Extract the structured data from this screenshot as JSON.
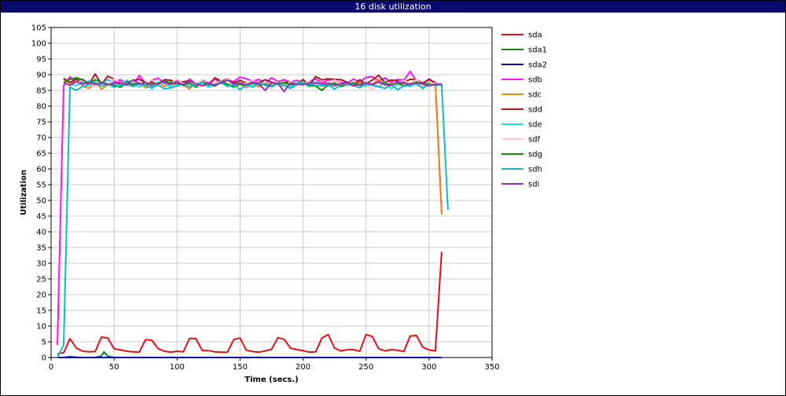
{
  "window": {
    "title": "16 disk utilization"
  },
  "chart_data": {
    "type": "line",
    "title": "16 disk utilization",
    "xlabel": "Time (secs.)",
    "ylabel": "Utilization",
    "xlim": [
      0,
      350
    ],
    "ylim": [
      0,
      105
    ],
    "xticks": [
      0,
      50,
      100,
      150,
      200,
      250,
      300,
      350
    ],
    "yticks": [
      0,
      5,
      10,
      15,
      20,
      25,
      30,
      35,
      40,
      45,
      50,
      55,
      60,
      65,
      70,
      75,
      80,
      85,
      90,
      95,
      100,
      105
    ],
    "grid": true,
    "legend_position": "right",
    "series": [
      {
        "name": "sda",
        "color": "#e0101a",
        "x": [
          5,
          10,
          15,
          20,
          25,
          30,
          35,
          40,
          45,
          50,
          55,
          60,
          65,
          70,
          75,
          80,
          85,
          90,
          95,
          100,
          105,
          110,
          115,
          120,
          125,
          130,
          135,
          140,
          145,
          150,
          155,
          160,
          165,
          170,
          175,
          180,
          185,
          190,
          195,
          200,
          205,
          210,
          215,
          220,
          225,
          230,
          235,
          240,
          245,
          250,
          255,
          260,
          265,
          270,
          275,
          280,
          285,
          290,
          295,
          300,
          305,
          310
        ],
        "y": [
          1.2,
          1.5,
          6.0,
          3.0,
          2.0,
          1.8,
          1.9,
          6.5,
          6.2,
          2.8,
          2.4,
          2.0,
          1.8,
          1.7,
          5.7,
          5.5,
          2.8,
          2.0,
          1.7,
          2.0,
          1.8,
          6.1,
          6.0,
          2.2,
          2.2,
          1.8,
          1.7,
          1.7,
          5.7,
          6.2,
          2.3,
          1.9,
          1.7,
          2.1,
          2.6,
          6.3,
          5.8,
          3.0,
          2.5,
          2.2,
          1.7,
          1.8,
          6.2,
          7.3,
          3.0,
          2.1,
          2.5,
          2.5,
          2.0,
          7.3,
          6.7,
          2.8,
          2.1,
          2.5,
          2.3,
          1.9,
          6.8,
          7.0,
          3.3,
          2.4,
          2.1,
          33.6
        ]
      },
      {
        "name": "sda1",
        "color": "#0a8a0a",
        "x": [
          5,
          10,
          15,
          20,
          25,
          30,
          35,
          40,
          42,
          45,
          50,
          55,
          60,
          100,
          150,
          200,
          250,
          300,
          310
        ],
        "y": [
          0,
          0,
          0.3,
          0.1,
          0,
          0,
          0,
          0.5,
          1.8,
          0.4,
          0,
          0,
          0,
          0,
          0,
          0,
          0,
          0,
          0
        ]
      },
      {
        "name": "sda2",
        "color": "#0a0aa8",
        "x": [
          5,
          310
        ],
        "y": [
          0,
          0
        ]
      },
      {
        "name": "sdb",
        "color": "#ff10ff",
        "x": [
          5,
          10,
          15,
          20,
          25,
          30,
          35,
          40,
          45,
          50,
          55,
          60,
          65,
          70,
          75,
          80,
          85,
          90,
          95,
          100,
          105,
          110,
          115,
          120,
          125,
          130,
          135,
          140,
          145,
          150,
          155,
          160,
          165,
          170,
          175,
          180,
          185,
          190,
          195,
          200,
          205,
          210,
          215,
          220,
          225,
          230,
          235,
          240,
          245,
          250,
          255,
          260,
          265,
          270,
          275,
          280,
          285,
          290,
          295,
          300,
          305,
          310
        ],
        "y": [
          4,
          86.5,
          89.3,
          87.5,
          88.6,
          87.0,
          86.5,
          87.2,
          88.4,
          87.6,
          88.4,
          87.2,
          86.8,
          89.7,
          87.3,
          88.2,
          88.9,
          87.0,
          87.6,
          88.1,
          86.8,
          88.6,
          87.0,
          88.2,
          87.3,
          88.6,
          87.2,
          88.3,
          87.8,
          89.2,
          88.7,
          87.9,
          88.5,
          87.2,
          89.0,
          87.8,
          88.4,
          87.6,
          88.2,
          87.3,
          87.8,
          88.6,
          87.4,
          88.3,
          88.1,
          87.5,
          87.3,
          88.6,
          87.7,
          89.1,
          89.4,
          87.8,
          89.0,
          87.6,
          88.5,
          88.2,
          91.0,
          88.0,
          87.4,
          88.3,
          87.6,
          46.0
        ]
      },
      {
        "name": "sdc",
        "color": "#e08a10",
        "x": [
          10,
          15,
          20,
          25,
          30,
          35,
          40,
          45,
          50,
          55,
          60,
          65,
          70,
          75,
          80,
          85,
          90,
          95,
          100,
          105,
          110,
          115,
          120,
          125,
          130,
          135,
          140,
          145,
          150,
          155,
          160,
          165,
          170,
          175,
          180,
          185,
          190,
          195,
          200,
          205,
          210,
          215,
          220,
          225,
          230,
          235,
          240,
          245,
          250,
          255,
          260,
          265,
          270,
          275,
          280,
          285,
          290,
          295,
          300,
          305,
          310
        ],
        "y": [
          88.5,
          87.0,
          88.0,
          86.5,
          85.6,
          87.6,
          85.4,
          86.8,
          87.4,
          86.6,
          86.9,
          86.2,
          87.6,
          85.8,
          86.5,
          87.4,
          86.2,
          87.1,
          87.0,
          86.6,
          85.5,
          87.4,
          86.4,
          86.8,
          86.4,
          87.6,
          86.2,
          86.8,
          87.0,
          85.8,
          87.3,
          86.2,
          87.4,
          86.9,
          87.1,
          86.3,
          87.6,
          87.0,
          88.5,
          86.5,
          87.7,
          87.2,
          87.5,
          86.4,
          87.3,
          86.9,
          86.5,
          87.6,
          86.7,
          86.9,
          88.5,
          86.6,
          87.3,
          86.7,
          87.5,
          86.9,
          87.5,
          86.9,
          87.4,
          87.2,
          45.5
        ]
      },
      {
        "name": "sdd",
        "color": "#a81a1a",
        "x": [
          10,
          15,
          20,
          25,
          30,
          35,
          40,
          45,
          50,
          55,
          60,
          65,
          70,
          75,
          80,
          85,
          90,
          95,
          100,
          105,
          110,
          115,
          120,
          125,
          130,
          135,
          140,
          145,
          150,
          155,
          160,
          165,
          170,
          175,
          180,
          185,
          190,
          195,
          200,
          205,
          210,
          215,
          220,
          225,
          230,
          235,
          240,
          245,
          250,
          255,
          260,
          265,
          270,
          275,
          280,
          285,
          290,
          295,
          300,
          305,
          310
        ],
        "y": [
          88.8,
          87.5,
          88.6,
          87.5,
          86.9,
          90.2,
          87.0,
          89.5,
          88.6,
          86.8,
          87.6,
          88.1,
          88.5,
          87.4,
          87.8,
          87.0,
          88.4,
          88.2,
          87.3,
          87.8,
          88.0,
          87.1,
          87.5,
          86.6,
          89.0,
          87.9,
          88.6,
          87.3,
          88.2,
          87.3,
          88.0,
          87.4,
          88.4,
          87.6,
          87.2,
          87.5,
          87.7,
          87.1,
          88.4,
          86.5,
          89.4,
          88.3,
          88.7,
          88.5,
          88.4,
          87.6,
          86.6,
          88.4,
          87.0,
          88.3,
          89.8,
          87.5,
          88.3,
          88.0,
          87.5,
          88.5,
          88.4,
          87.2,
          88.6,
          87.3,
          87.0
        ]
      },
      {
        "name": "sde",
        "color": "#20e0e0",
        "x": [
          15,
          20,
          25,
          30,
          35,
          40,
          45,
          50,
          55,
          60,
          65,
          70,
          75,
          80,
          85,
          90,
          95,
          100,
          105,
          110,
          115,
          120,
          125,
          130,
          135,
          140,
          145,
          150,
          155,
          160,
          165,
          170,
          175,
          180,
          185,
          190,
          195,
          200,
          205,
          210,
          215,
          220,
          225,
          230,
          235,
          240,
          245,
          250,
          255,
          260,
          265,
          270,
          275,
          280,
          285,
          290,
          295,
          300,
          305,
          310
        ],
        "y": [
          87.0,
          86.6,
          87.4,
          88.0,
          86.9,
          87.0,
          88.3,
          87.2,
          86.5,
          88.3,
          87.5,
          86.0,
          87.6,
          85.4,
          87.6,
          87.3,
          86.0,
          86.8,
          87.3,
          86.2,
          87.4,
          87.6,
          86.0,
          86.8,
          88.1,
          86.9,
          85.8,
          87.2,
          86.6,
          86.8,
          87.0,
          87.5,
          86.3,
          87.4,
          86.7,
          86.0,
          87.4,
          87.6,
          86.1,
          87.5,
          87.1,
          86.3,
          86.8,
          87.0,
          86.4,
          87.3,
          86.7,
          86.4,
          87.0,
          86.0,
          87.5,
          85.5,
          87.0,
          86.5,
          86.3,
          87.3,
          85.5,
          87.2,
          86.5,
          87.0
        ]
      },
      {
        "name": "sdf",
        "color": "#ffc8c8",
        "x": [
          10,
          15,
          20,
          25,
          30,
          35,
          40,
          45,
          50,
          55,
          60,
          65,
          70,
          75,
          80,
          85,
          90,
          95,
          100,
          105,
          110,
          115,
          120,
          125,
          130,
          135,
          140,
          145,
          150,
          155,
          160,
          165,
          170,
          175,
          180,
          185,
          190,
          195,
          200,
          205,
          210,
          215,
          220,
          225,
          230,
          235,
          240,
          245,
          250,
          255,
          260,
          265,
          270,
          275,
          280,
          285,
          290,
          295,
          300,
          305,
          310
        ],
        "y": [
          87.8,
          86.8,
          87.4,
          88.2,
          87.0,
          86.5,
          87.8,
          87.0,
          88.6,
          87.4,
          86.8,
          87.9,
          87.4,
          87.0,
          88.4,
          86.9,
          87.6,
          87.2,
          88.6,
          87.0,
          86.8,
          87.5,
          88.0,
          86.9,
          87.6,
          87.4,
          88.5,
          86.6,
          87.4,
          87.2,
          88.3,
          86.8,
          87.5,
          85.4,
          87.6,
          86.4,
          87.8,
          87.0,
          87.2,
          87.8,
          86.4,
          85.0,
          87.6,
          88.3,
          87.0,
          86.7,
          87.6,
          86.4,
          87.0,
          85.2,
          86.8,
          87.2,
          86.6,
          87.7,
          88.0,
          87.2,
          88.4,
          86.6,
          87.2,
          87.3,
          87.0
        ]
      },
      {
        "name": "sdg",
        "color": "#10900a",
        "x": [
          10,
          15,
          20,
          25,
          30,
          35,
          40,
          45,
          50,
          55,
          60,
          65,
          70,
          75,
          80,
          85,
          90,
          95,
          100,
          105,
          110,
          115,
          120,
          125,
          130,
          135,
          140,
          145,
          150,
          155,
          160,
          165,
          170,
          175,
          180,
          185,
          190,
          195,
          200,
          205,
          210,
          215,
          220,
          225,
          230,
          235,
          240,
          245,
          250,
          255,
          260,
          265,
          270,
          275,
          280,
          285,
          290,
          295,
          300,
          305,
          310
        ],
        "y": [
          87.5,
          88.5,
          89.0,
          88.4,
          87.0,
          88.4,
          87.6,
          87.0,
          86.6,
          86.0,
          87.4,
          86.9,
          87.2,
          86.6,
          87.4,
          87.0,
          88.0,
          87.4,
          87.2,
          86.6,
          87.4,
          86.0,
          87.6,
          87.0,
          86.4,
          87.6,
          87.0,
          86.2,
          87.0,
          86.6,
          87.4,
          86.9,
          87.0,
          86.2,
          87.3,
          87.4,
          86.8,
          87.0,
          87.4,
          86.5,
          86.4,
          85.0,
          86.8,
          87.4,
          86.2,
          87.0,
          87.4,
          86.6,
          87.0,
          86.8,
          87.6,
          87.2,
          86.8,
          87.4,
          86.4,
          87.0,
          87.6,
          87.2,
          87.0,
          86.6,
          87.0
        ]
      },
      {
        "name": "sdh",
        "color": "#10b8c8",
        "x": [
          5,
          10,
          15,
          20,
          25,
          30,
          35,
          40,
          45,
          50,
          55,
          60,
          65,
          70,
          75,
          80,
          85,
          90,
          95,
          100,
          105,
          110,
          115,
          120,
          125,
          130,
          135,
          140,
          145,
          150,
          155,
          160,
          165,
          170,
          175,
          180,
          185,
          190,
          195,
          200,
          205,
          210,
          215,
          220,
          225,
          230,
          235,
          240,
          245,
          250,
          255,
          260,
          265,
          270,
          275,
          280,
          285,
          290,
          295,
          300,
          305,
          310,
          315
        ],
        "y": [
          0,
          4,
          86.0,
          85.0,
          86.2,
          86.8,
          87.6,
          86.4,
          87.0,
          86.0,
          86.6,
          87.2,
          86.2,
          87.0,
          86.6,
          86.0,
          86.6,
          85.5,
          85.8,
          86.4,
          87.0,
          86.2,
          86.8,
          87.4,
          86.4,
          86.9,
          87.4,
          86.3,
          87.0,
          85.2,
          86.8,
          86.0,
          87.4,
          86.6,
          86.2,
          87.0,
          86.6,
          85.6,
          86.8,
          87.4,
          87.0,
          86.6,
          86.4,
          86.9,
          85.4,
          86.8,
          87.0,
          86.6,
          85.8,
          87.2,
          86.6,
          86.2,
          85.6,
          86.8,
          85.2,
          86.4,
          86.6,
          87.0,
          85.8,
          86.8,
          86.6,
          86.8,
          47.0
        ]
      },
      {
        "name": "sdi",
        "color": "#9a30b8",
        "x": [
          10,
          15,
          20,
          25,
          30,
          35,
          40,
          45,
          50,
          55,
          60,
          65,
          70,
          75,
          80,
          85,
          90,
          95,
          100,
          105,
          110,
          115,
          120,
          125,
          130,
          135,
          140,
          145,
          150,
          155,
          160,
          165,
          170,
          175,
          180,
          185,
          190,
          195,
          200,
          205,
          210,
          215,
          220,
          225,
          230,
          235,
          240,
          245,
          250,
          255,
          260,
          265,
          270,
          275,
          280,
          285,
          290,
          295,
          300,
          305,
          310
        ],
        "y": [
          87.5,
          86.6,
          87.8,
          87.0,
          87.6,
          86.9,
          87.4,
          86.8,
          87.2,
          87.6,
          86.6,
          88.4,
          87.0,
          87.4,
          86.8,
          87.3,
          87.6,
          86.8,
          87.5,
          86.9,
          88.0,
          87.0,
          86.5,
          87.4,
          86.6,
          87.5,
          88.2,
          87.0,
          87.4,
          86.8,
          87.6,
          87.0,
          85.0,
          87.5,
          87.2,
          84.6,
          87.4,
          87.0,
          86.8,
          87.4,
          87.3,
          87.0,
          87.2,
          86.6,
          87.0,
          87.4,
          86.4,
          86.9,
          87.4,
          86.9,
          87.6,
          86.8,
          86.6,
          87.8,
          87.2,
          87.0,
          87.4,
          87.0,
          86.4,
          87.0,
          86.8
        ]
      }
    ]
  }
}
